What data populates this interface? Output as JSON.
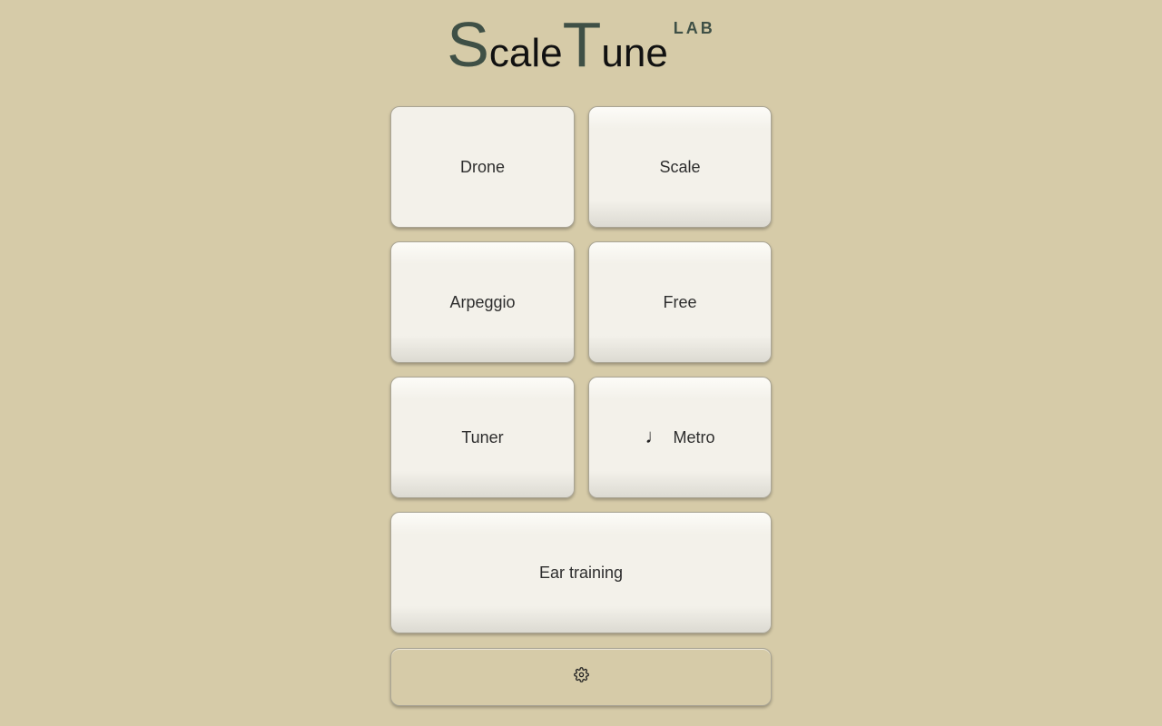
{
  "logo": {
    "initial_1": "S",
    "rest_1": "cale",
    "initial_2": "T",
    "rest_2": "une",
    "suffix": "LAB"
  },
  "menu": {
    "drone": "Drone",
    "scale": "Scale",
    "arpeggio": "Arpeggio",
    "free": "Free",
    "tuner": "Tuner",
    "metro_icon": "♩",
    "metro": "Metro",
    "ear_training": "Ear training"
  },
  "icons": {
    "metro": "quarter-note-icon",
    "settings": "gear-icon"
  },
  "colors": {
    "background": "#d6cba8",
    "accent": "#3f5046",
    "button": "#f3f1ea"
  }
}
